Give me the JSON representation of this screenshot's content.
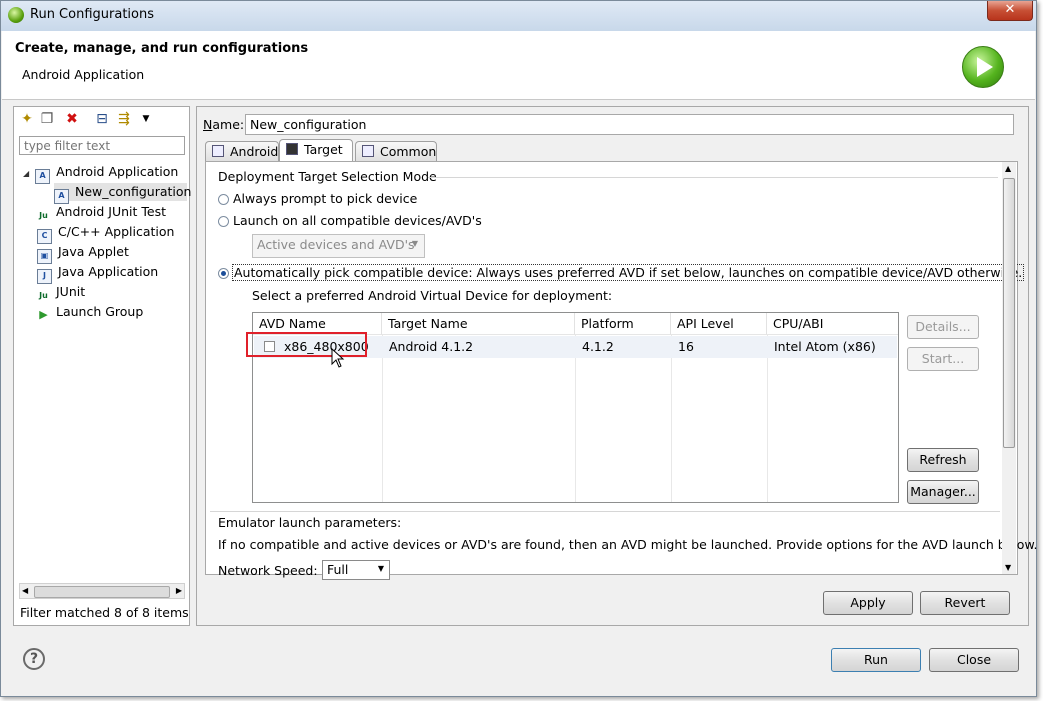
{
  "window": {
    "title": "Run Configurations",
    "close_label": "✕"
  },
  "header": {
    "title": "Create, manage, and run configurations",
    "subtitle": "Android Application"
  },
  "left": {
    "filter_placeholder": "type filter text",
    "tree": [
      {
        "label": "Android Application",
        "expanded": true,
        "icon": "android-app-icon"
      },
      {
        "label": "New_configuration",
        "child": true,
        "selected": true,
        "icon": "android-config-icon"
      },
      {
        "label": "Android JUnit Test",
        "icon": "junit-icon"
      },
      {
        "label": "C/C++ Application",
        "icon": "cpp-app-icon"
      },
      {
        "label": "Java Applet",
        "icon": "java-applet-icon"
      },
      {
        "label": "Java Application",
        "icon": "java-app-icon"
      },
      {
        "label": "JUnit",
        "icon": "junit-icon"
      },
      {
        "label": "Launch Group",
        "icon": "launch-group-icon"
      }
    ],
    "status": "Filter matched 8 of 8 items"
  },
  "config": {
    "name_label": "Name:",
    "name_value": "New_configuration",
    "tabs": [
      "Android",
      "Target",
      "Common"
    ],
    "active_tab": "Target",
    "group_label": "Deployment Target Selection Mode",
    "radio_prompt": "Always prompt to pick device",
    "radio_all": "Launch on all compatible devices/AVD's",
    "active_combo": "Active devices and AVD's",
    "radio_auto": "Automatically pick compatible device: Always uses preferred AVD if set below, launches on compatible device/AVD otherwise.",
    "select_label": "Select a preferred Android Virtual Device for deployment:",
    "columns": [
      "AVD Name",
      "Target Name",
      "Platform",
      "API Level",
      "CPU/ABI"
    ],
    "rows": [
      {
        "avd": "x86_480x800",
        "target": "Android 4.1.2",
        "platform": "4.1.2",
        "api": "16",
        "cpu": "Intel Atom (x86)",
        "checked": false
      }
    ],
    "buttons": {
      "details": "Details...",
      "start": "Start...",
      "refresh": "Refresh",
      "manager": "Manager..."
    },
    "emulator_label": "Emulator launch parameters:",
    "emulator_desc": "If no compatible and active devices or AVD's are found, then an AVD might be launched. Provide options for the AVD launch below.",
    "network_label": "Network Speed:",
    "network_value": "Full",
    "apply": "Apply",
    "revert": "Revert"
  },
  "footer": {
    "run": "Run",
    "close": "Close",
    "help": "?"
  }
}
